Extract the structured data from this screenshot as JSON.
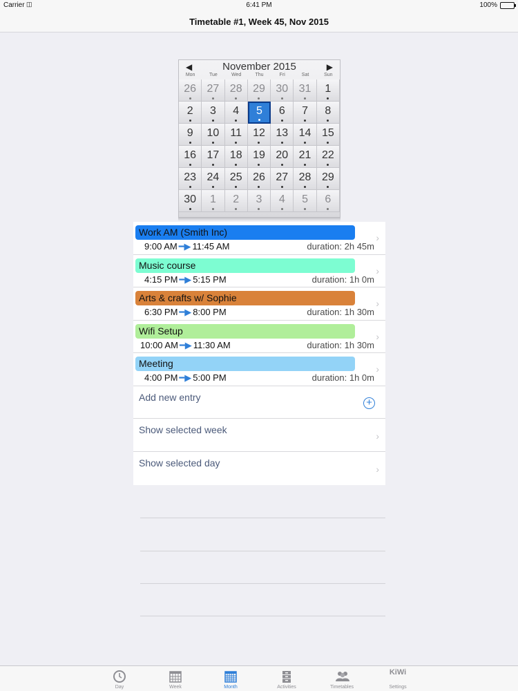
{
  "status_bar": {
    "carrier": "Carrier",
    "time": "6:41 PM",
    "battery": "100%"
  },
  "nav": {
    "title": "Timetable #1, Week 45, Nov 2015"
  },
  "calendar": {
    "month_label": "November 2015",
    "weekdays": [
      "Mon",
      "Tue",
      "Wed",
      "Thu",
      "Fri",
      "Sat",
      "Sun"
    ],
    "days": [
      {
        "d": "26",
        "other": true
      },
      {
        "d": "27",
        "other": true
      },
      {
        "d": "28",
        "other": true
      },
      {
        "d": "29",
        "other": true
      },
      {
        "d": "30",
        "other": true
      },
      {
        "d": "31",
        "other": true
      },
      {
        "d": "1"
      },
      {
        "d": "2"
      },
      {
        "d": "3"
      },
      {
        "d": "4"
      },
      {
        "d": "5",
        "selected": true
      },
      {
        "d": "6"
      },
      {
        "d": "7"
      },
      {
        "d": "8"
      },
      {
        "d": "9"
      },
      {
        "d": "10"
      },
      {
        "d": "11"
      },
      {
        "d": "12"
      },
      {
        "d": "13"
      },
      {
        "d": "14"
      },
      {
        "d": "15"
      },
      {
        "d": "16"
      },
      {
        "d": "17"
      },
      {
        "d": "18"
      },
      {
        "d": "19"
      },
      {
        "d": "20"
      },
      {
        "d": "21"
      },
      {
        "d": "22"
      },
      {
        "d": "23"
      },
      {
        "d": "24"
      },
      {
        "d": "25"
      },
      {
        "d": "26"
      },
      {
        "d": "27"
      },
      {
        "d": "28"
      },
      {
        "d": "29"
      },
      {
        "d": "30"
      },
      {
        "d": "1",
        "other": true
      },
      {
        "d": "2",
        "other": true
      },
      {
        "d": "3",
        "other": true
      },
      {
        "d": "4",
        "other": true
      },
      {
        "d": "5",
        "other": true
      },
      {
        "d": "6",
        "other": true
      }
    ]
  },
  "entries": [
    {
      "name": "Work AM (Smith Inc)",
      "start": "9:00 AM",
      "end": "11:45 AM",
      "duration": "duration: 2h 45m",
      "color": "#1a7ef0"
    },
    {
      "name": "Music course",
      "start": "4:15 PM",
      "end": "5:15 PM",
      "duration": "duration: 1h 0m",
      "color": "#7dfdd2"
    },
    {
      "name": "Arts & crafts w/ Sophie",
      "start": "6:30 PM",
      "end": "8:00 PM",
      "duration": "duration: 1h 30m",
      "color": "#d9823a"
    },
    {
      "name": "Wifi Setup",
      "start": "10:00 AM",
      "end": "11:30 AM",
      "duration": "duration: 1h 30m",
      "color": "#b0ee9a"
    },
    {
      "name": "Meeting",
      "start": "4:00 PM",
      "end": "5:00 PM",
      "duration": "duration: 1h 0m",
      "color": "#93d3f7"
    }
  ],
  "actions": {
    "add_entry": "Add new entry",
    "show_week": "Show selected week",
    "show_day": "Show selected day"
  },
  "tabs": [
    {
      "label": "Day",
      "icon": "clock-icon"
    },
    {
      "label": "Week",
      "icon": "week-calendar-icon"
    },
    {
      "label": "Month",
      "icon": "month-calendar-icon",
      "active": true
    },
    {
      "label": "Activities",
      "icon": "cabinet-icon"
    },
    {
      "label": "Timetables",
      "icon": "people-icon"
    },
    {
      "label": "Settings",
      "icon": "kiwi-logo",
      "logo_text": "KiWi"
    }
  ]
}
